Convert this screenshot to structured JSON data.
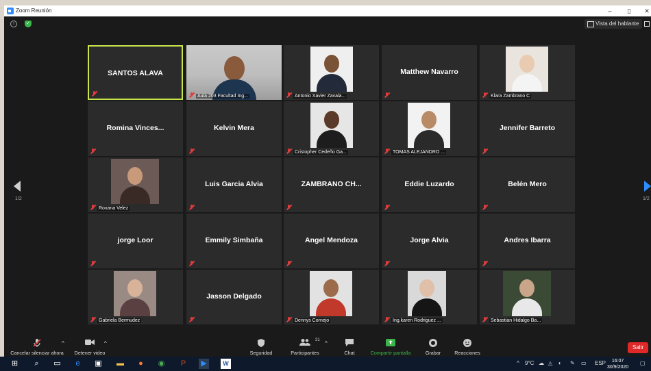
{
  "window": {
    "title": "Zoom Reunión"
  },
  "topbar": {
    "speaker_view_label": "Vista del hablante"
  },
  "pager": {
    "left": "1/2",
    "right": "1/2"
  },
  "participants": [
    {
      "name": "SANTOS ALAVA",
      "label": "",
      "active": true
    },
    {
      "name": "",
      "label": "Aula 203 Facultad Ing..."
    },
    {
      "name": "",
      "label": "Antonio Xavier Zavala..."
    },
    {
      "name": "Matthew Navarro",
      "label": ""
    },
    {
      "name": "",
      "label": "Klara Zambrano C"
    },
    {
      "name": "Romina  Vinces...",
      "label": ""
    },
    {
      "name": "Kelvin Mera",
      "label": ""
    },
    {
      "name": "",
      "label": "Cristopher Cedeño Ga..."
    },
    {
      "name": "",
      "label": "TOMAS ALEJANDRO ..."
    },
    {
      "name": "Jennifer Barreto",
      "label": ""
    },
    {
      "name": "",
      "label": "Roxana Velez"
    },
    {
      "name": "Luis Garcia Alvia",
      "label": ""
    },
    {
      "name": "ZAMBRANO  CH...",
      "label": ""
    },
    {
      "name": "Eddie Luzardo",
      "label": ""
    },
    {
      "name": "Belén Mero",
      "label": ""
    },
    {
      "name": "jorge Loor",
      "label": ""
    },
    {
      "name": "Emmily Simbaña",
      "label": ""
    },
    {
      "name": "Angel Mendoza",
      "label": ""
    },
    {
      "name": "Jorge Alvia",
      "label": ""
    },
    {
      "name": "Andres Ibarra",
      "label": ""
    },
    {
      "name": "",
      "label": "Gabriela Bermudez"
    },
    {
      "name": "Jasson Delgado",
      "label": ""
    },
    {
      "name": "",
      "label": "Dennys Cornejo"
    },
    {
      "name": "",
      "label": "Ing.karen Rodriguez ..."
    },
    {
      "name": "",
      "label": "Sebastian  Hidalgo Ba..."
    }
  ],
  "toolbar": {
    "unmute": "Cancelar silenciar ahora",
    "stop_video": "Detener video",
    "security": "Seguridad",
    "participants": "Participantes",
    "participants_count": "31",
    "chat": "Chat",
    "share": "Compartir pantalla",
    "record": "Grabar",
    "reactions": "Reacciones",
    "leave": "Salir"
  },
  "taskbar": {
    "temp": "9°C",
    "lang": "ESP",
    "time": "16:07",
    "date": "30/9/2020"
  },
  "colors": {
    "active_border": "#c8e64a",
    "leave": "#e02828",
    "share": "#3bb54a",
    "accent": "#2d8cff"
  }
}
